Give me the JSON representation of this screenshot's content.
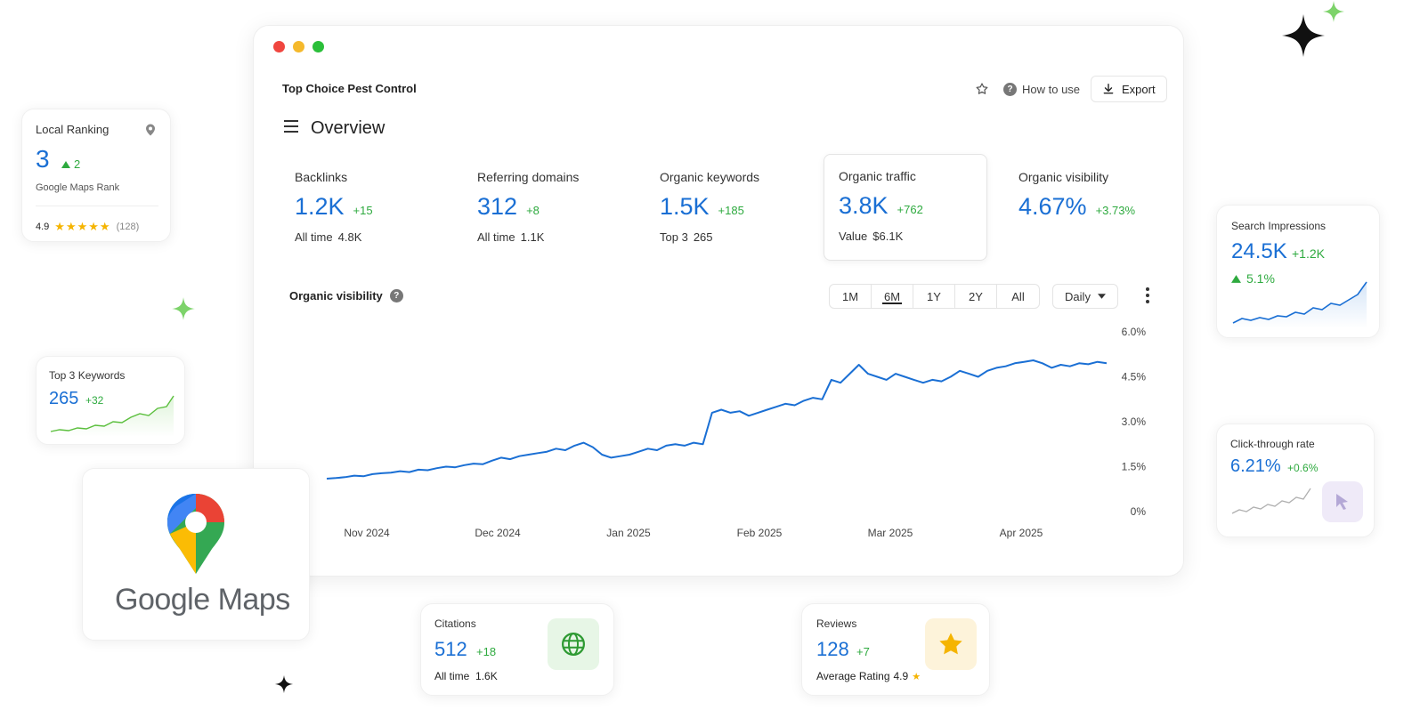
{
  "window": {
    "company": "Top Choice Pest Control",
    "how_to_use": "How to use",
    "export": "Export",
    "title": "Overview"
  },
  "metrics": [
    {
      "label": "Backlinks",
      "value": "1.2K",
      "delta": "+15",
      "sub_label": "All time",
      "sub_value": "4.8K"
    },
    {
      "label": "Referring domains",
      "value": "312",
      "delta": "+8",
      "sub_label": "All time",
      "sub_value": "1.1K"
    },
    {
      "label": "Organic keywords",
      "value": "1.5K",
      "delta": "+185",
      "sub_label": "Top 3",
      "sub_value": "265"
    },
    {
      "label": "Organic traffic",
      "value": "3.8K",
      "delta": "+762",
      "sub_label": "Value",
      "sub_value": "$6.1K"
    },
    {
      "label": "Organic visibility",
      "value": "4.67%",
      "delta": "+3.73%",
      "sub_label": "",
      "sub_value": ""
    }
  ],
  "chart_panel": {
    "title": "Organic visibility",
    "ranges": [
      "1M",
      "6M",
      "1Y",
      "2Y",
      "All"
    ],
    "active_range": "6M",
    "interval": "Daily"
  },
  "chart_data": {
    "type": "line",
    "title": "Organic visibility",
    "x_ticks": [
      "Nov 2024",
      "Dec 2024",
      "Jan 2025",
      "Feb 2025",
      "Mar 2025",
      "Apr 2025"
    ],
    "y_ticks": [
      "0%",
      "1.5%",
      "3.0%",
      "4.5%",
      "6.0%"
    ],
    "ylim": [
      0,
      6.0
    ],
    "series": [
      {
        "color": "#1a6fd4",
        "values": [
          1.1,
          1.12,
          1.15,
          1.2,
          1.18,
          1.25,
          1.28,
          1.3,
          1.35,
          1.32,
          1.4,
          1.38,
          1.45,
          1.5,
          1.48,
          1.55,
          1.6,
          1.58,
          1.7,
          1.8,
          1.75,
          1.85,
          1.9,
          1.95,
          2.0,
          2.1,
          2.05,
          2.2,
          2.3,
          2.15,
          1.9,
          1.8,
          1.85,
          1.9,
          2.0,
          2.1,
          2.05,
          2.2,
          2.25,
          2.2,
          2.3,
          2.25,
          3.3,
          3.4,
          3.3,
          3.35,
          3.2,
          3.3,
          3.4,
          3.5,
          3.6,
          3.55,
          3.7,
          3.8,
          3.75,
          4.4,
          4.3,
          4.6,
          4.9,
          4.6,
          4.5,
          4.4,
          4.6,
          4.5,
          4.4,
          4.3,
          4.4,
          4.35,
          4.5,
          4.7,
          4.6,
          4.5,
          4.7,
          4.8,
          4.85,
          4.95,
          5.0,
          5.05,
          4.95,
          4.8,
          4.9,
          4.85,
          4.95,
          4.92,
          5.0,
          4.95
        ]
      }
    ]
  },
  "local_ranking": {
    "label": "Local Ranking",
    "value": "3",
    "delta": "2",
    "sub": "Google Maps Rank",
    "rating": "4.9",
    "count": "(128)"
  },
  "top3": {
    "label": "Top 3 Keywords",
    "value": "265",
    "delta": "+32"
  },
  "google_maps": {
    "logo_text": "Google Maps"
  },
  "citations": {
    "label": "Citations",
    "value": "512",
    "delta": "+18",
    "sub_label": "All time",
    "sub_value": "1.6K"
  },
  "reviews": {
    "label": "Reviews",
    "value": "128",
    "delta": "+7",
    "sub_label": "Average Rating",
    "sub_value": "4.9"
  },
  "search_impressions": {
    "label": "Search Impressions",
    "value": "24.5K",
    "delta": "+1.2K",
    "change": "5.1%"
  },
  "ctr": {
    "label": "Click-through rate",
    "value": "6.21%",
    "delta": "+0.6%"
  },
  "colors": {
    "accent": "#1a6fd4",
    "positive": "#2eaa3f",
    "star": "#f5b400"
  }
}
